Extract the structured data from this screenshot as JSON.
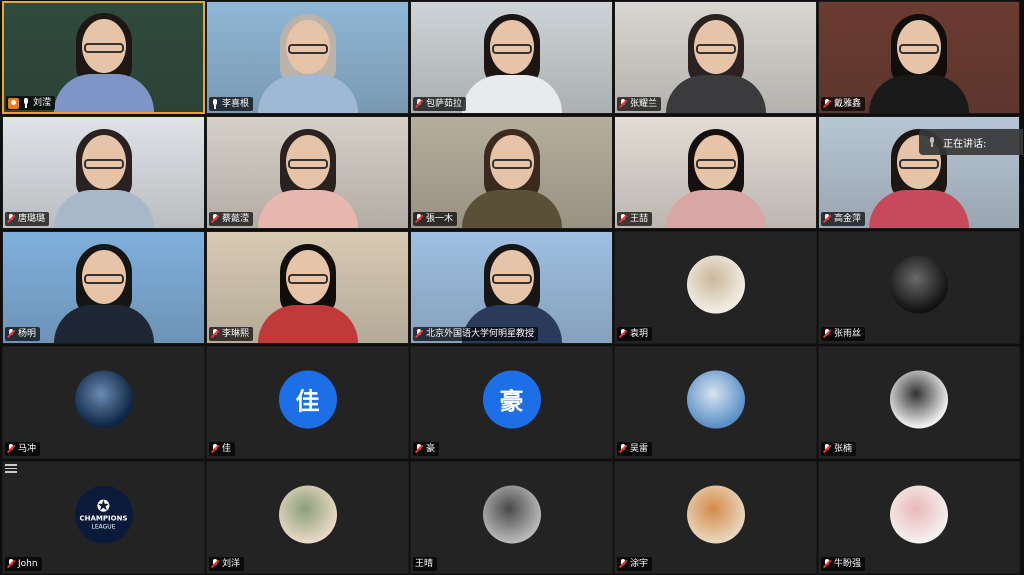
{
  "meeting": {
    "speaking_label": "正在讲话:",
    "participants": [
      {
        "name": "刘滢",
        "mic": "on",
        "host": true,
        "speaking": true,
        "kind": "video",
        "bg": "#2f4a3c",
        "hair": "#1e1714",
        "shirt": "#7f95c8"
      },
      {
        "name": "李喜根",
        "mic": "on",
        "kind": "video",
        "bg": "#8fb7d6",
        "hair": "#b9b3aa",
        "shirt": "#9fb8d8"
      },
      {
        "name": "包萨茹拉",
        "mic": "muted",
        "kind": "video",
        "bg": "#cdd3d6",
        "hair": "#1b1614",
        "shirt": "#e8eaee"
      },
      {
        "name": "张耀兰",
        "mic": "muted",
        "kind": "video",
        "bg": "#d9d6d1",
        "hair": "#2a2220",
        "shirt": "#3b3b3d"
      },
      {
        "name": "戴雅鑫",
        "mic": "muted",
        "kind": "video",
        "bg": "#6b3b30",
        "hair": "#120e0c",
        "shirt": "#1a1a1a"
      },
      {
        "name": "唐璐璐",
        "mic": "muted",
        "kind": "video",
        "bg": "#dfe3e7",
        "hair": "#2a2220",
        "shirt": "#a8b8c8"
      },
      {
        "name": "蔡懿滢",
        "mic": "muted",
        "kind": "video",
        "bg": "#d6cfc6",
        "hair": "#2a2220",
        "shirt": "#e8b8b0"
      },
      {
        "name": "張一木",
        "mic": "muted",
        "kind": "video",
        "bg": "#b6ae9c",
        "hair": "#3a2a20",
        "shirt": "#5a5038"
      },
      {
        "name": "王喆",
        "mic": "muted",
        "kind": "video",
        "bg": "#e1dcd4",
        "hair": "#141010",
        "shirt": "#d8a6a4"
      },
      {
        "name": "高金萍",
        "mic": "muted",
        "kind": "video",
        "bg": "#b7c6d4",
        "hair": "#1c1614",
        "shirt": "#c8485c"
      },
      {
        "name": "杨明",
        "mic": "muted",
        "kind": "video",
        "bg": "#7fb0dc",
        "hair": "#151515",
        "shirt": "#1e2633"
      },
      {
        "name": "李琳熙",
        "mic": "muted",
        "kind": "video",
        "bg": "#d8cbb4",
        "hair": "#120e0c",
        "shirt": "#c03a3a"
      },
      {
        "name": "北京外国语大学何明星教授",
        "mic": "muted",
        "kind": "video",
        "bg": "#9ec0e2",
        "hair": "#161616",
        "shirt": "#2a3a5a"
      },
      {
        "name": "袁玥",
        "mic": "muted",
        "kind": "avatar",
        "avatar": "dog-avatar",
        "a1": "#f2ede4",
        "a2": "#c9b79b"
      },
      {
        "name": "张雨丝",
        "mic": "muted",
        "kind": "avatar",
        "avatar": "portrait-avatar",
        "a1": "#111",
        "a2": "#6a6a6a"
      },
      {
        "name": "马冲",
        "mic": "muted",
        "kind": "avatar",
        "avatar": "space-avatar",
        "a1": "#0d2442",
        "a2": "#6a8cb4"
      },
      {
        "name": "佳",
        "mic": "muted",
        "kind": "letter",
        "letter": "佳"
      },
      {
        "name": "豪",
        "mic": "muted",
        "kind": "letter",
        "letter": "豪"
      },
      {
        "name": "吴雷",
        "mic": "muted",
        "kind": "avatar",
        "avatar": "sky-avatar",
        "a1": "#5a8fc8",
        "a2": "#d8e4ee"
      },
      {
        "name": "张楠",
        "mic": "muted",
        "kind": "avatar",
        "avatar": "sketch-avatar",
        "a1": "#efefef",
        "a2": "#333"
      },
      {
        "name": "John",
        "mic": "muted",
        "kind": "avatar",
        "avatar": "champions-league-avatar",
        "a1": "#0a1a3a",
        "a2": "#ffffff",
        "text1": "CHAMPIONS",
        "text2": "LEAGUE"
      },
      {
        "name": "刘洋",
        "mic": "muted",
        "kind": "avatar",
        "avatar": "flower-avatar",
        "a1": "#e8d8c4",
        "a2": "#8aa07a"
      },
      {
        "name": "王晴",
        "mic": "none",
        "kind": "avatar",
        "avatar": "photo-avatar",
        "a1": "#b8b8b8",
        "a2": "#4a4a4a"
      },
      {
        "name": "涂宇",
        "mic": "muted",
        "kind": "avatar",
        "avatar": "woman-photo-avatar",
        "a1": "#e8d6bc",
        "a2": "#d48a4a"
      },
      {
        "name": "牛盼强",
        "mic": "muted",
        "kind": "avatar",
        "avatar": "cartoon-avatar",
        "a1": "#f4f1ee",
        "a2": "#e8b8b8"
      }
    ]
  }
}
